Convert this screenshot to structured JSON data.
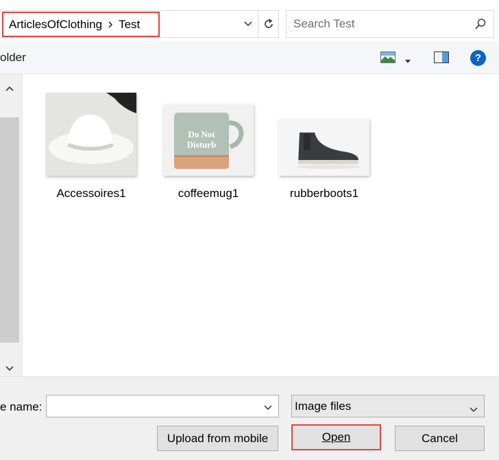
{
  "address_bar": {
    "breadcrumbs": [
      "ArticlesOfClothing",
      "Test"
    ]
  },
  "search": {
    "placeholder": "Search Test"
  },
  "toolbar": {
    "new_folder_label": "older",
    "icons": [
      "view-options-icon",
      "preview-pane-icon",
      "help-icon"
    ],
    "help_glyph": "?"
  },
  "files": [
    {
      "name": "Accessoires1",
      "thumbnail": "white-cowboy-hat"
    },
    {
      "name": "coffeemug1",
      "thumbnail": "sage-mug",
      "thumb_text": [
        "Do Not",
        "Disturb"
      ]
    },
    {
      "name": "rubberboots1",
      "thumbnail": "black-chelsea-boot"
    }
  ],
  "bottom": {
    "file_name_label": "e name:",
    "file_name_value": "",
    "file_type_filter": "Image files",
    "upload_button": "Upload from mobile",
    "open_button": "Open",
    "cancel_button": "Cancel"
  },
  "colors": {
    "highlight_border": "#e8413e",
    "help_blue": "#0a64c8"
  }
}
